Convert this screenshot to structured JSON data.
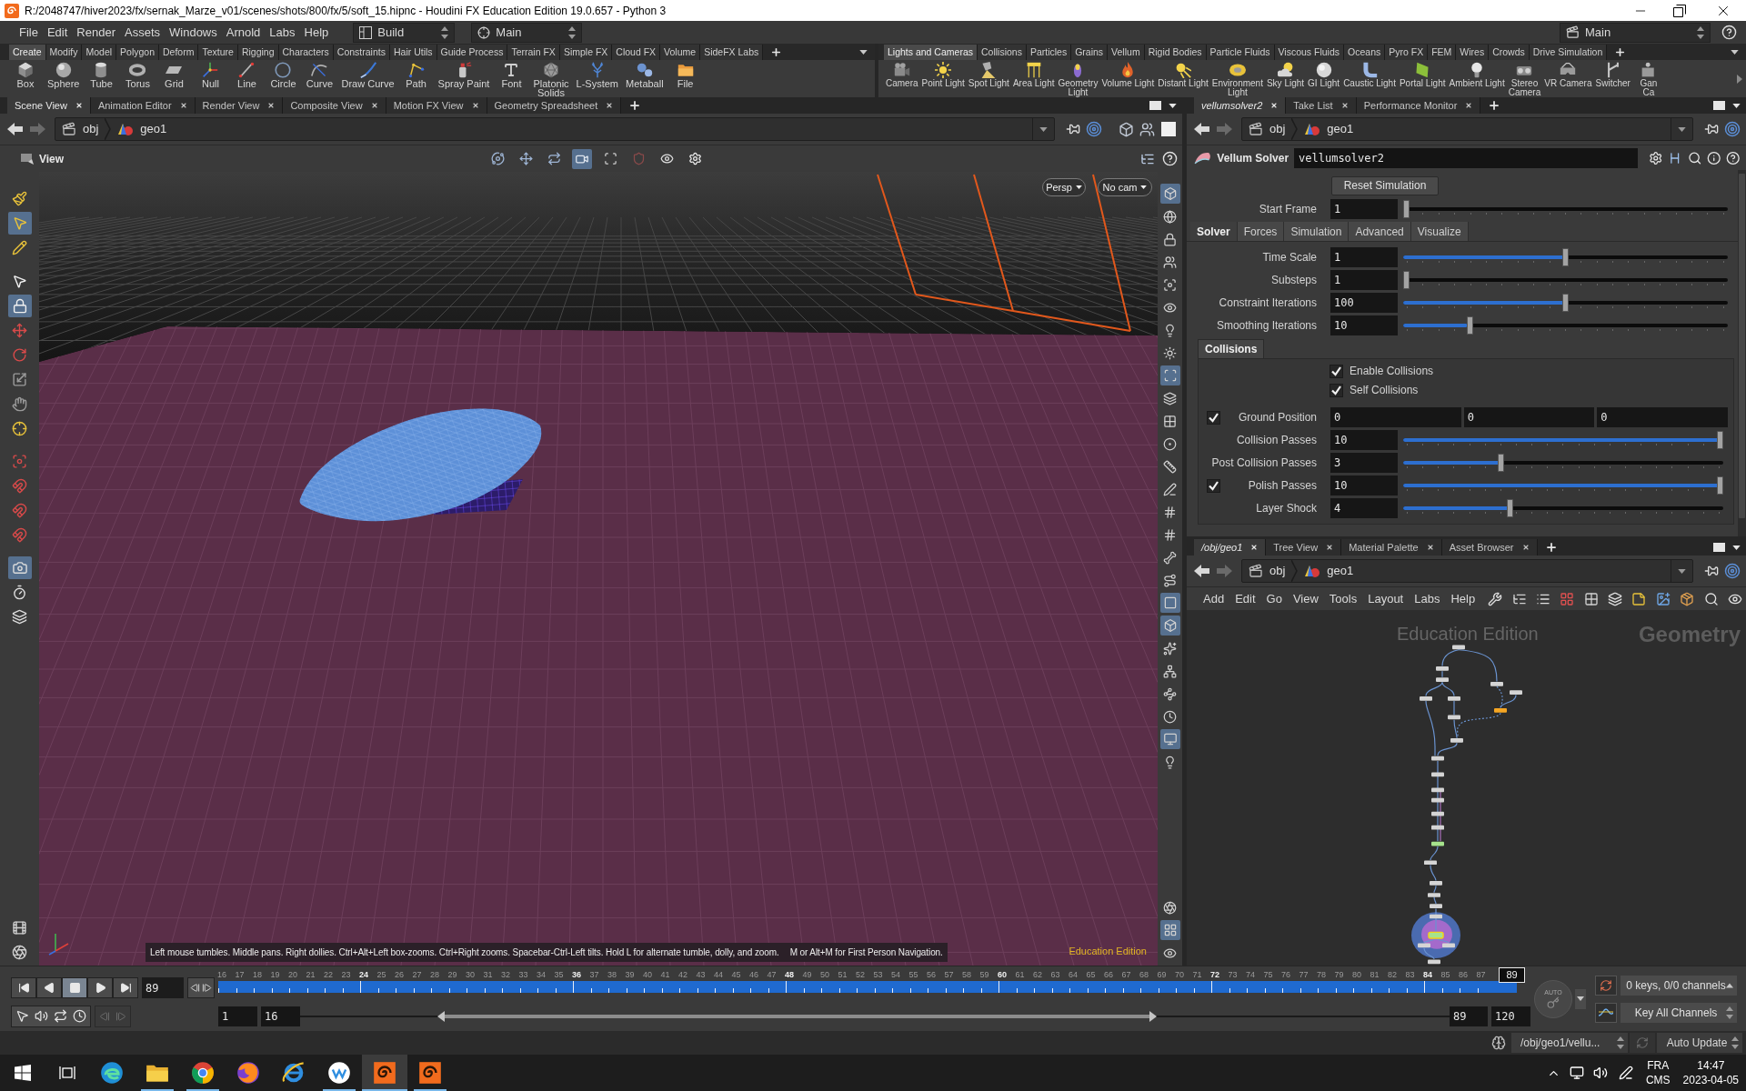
{
  "window": {
    "title": "R:/2048747/hiver2023/fx/sernak_Marze_v01/scenes/shots/800/fx/5/soft_15.hipnc - Houdini FX Education Edition 19.0.657 - Python 3"
  },
  "menu_bar": {
    "items": [
      "File",
      "Edit",
      "Render",
      "Assets",
      "Windows",
      "Arnold",
      "Labs",
      "Help"
    ],
    "desktop": "Build",
    "context": "Main",
    "desk": "Main"
  },
  "shelves": [
    {
      "tabs": [
        {
          "label": "Create",
          "selected": true
        },
        {
          "label": "Modify",
          "selected": false
        },
        {
          "label": "Model",
          "selected": false
        },
        {
          "label": "Polygon",
          "selected": false
        },
        {
          "label": "Deform",
          "selected": false
        },
        {
          "label": "Texture",
          "selected": false
        },
        {
          "label": "Rigging",
          "selected": false
        },
        {
          "label": "Characters",
          "selected": false
        },
        {
          "label": "Constraints",
          "selected": false
        },
        {
          "label": "Hair Utils",
          "selected": false
        },
        {
          "label": "Guide Process",
          "selected": false
        },
        {
          "label": "Terrain FX",
          "selected": false
        },
        {
          "label": "Simple FX",
          "selected": false
        },
        {
          "label": "Cloud FX",
          "selected": false
        },
        {
          "label": "Volume",
          "selected": false
        },
        {
          "label": "SideFX Labs",
          "selected": false
        }
      ],
      "tools": [
        "Box",
        "Sphere",
        "Tube",
        "Torus",
        "Grid",
        "Null",
        "Line",
        "Circle",
        "Curve",
        "Draw Curve",
        "Path",
        "Spray Paint",
        "Font",
        "Platonic\nSolids",
        "L-System",
        "Metaball",
        "File"
      ]
    },
    {
      "tabs": [
        {
          "label": "Lights and Cameras",
          "selected": true
        },
        {
          "label": "Collisions",
          "selected": false
        },
        {
          "label": "Particles",
          "selected": false
        },
        {
          "label": "Grains",
          "selected": false
        },
        {
          "label": "Vellum",
          "selected": false
        },
        {
          "label": "Rigid Bodies",
          "selected": false
        },
        {
          "label": "Particle Fluids",
          "selected": false
        },
        {
          "label": "Viscous Fluids",
          "selected": false
        },
        {
          "label": "Oceans",
          "selected": false
        },
        {
          "label": "Pyro FX",
          "selected": false
        },
        {
          "label": "FEM",
          "selected": false
        },
        {
          "label": "Wires",
          "selected": false
        },
        {
          "label": "Crowds",
          "selected": false
        },
        {
          "label": "Drive Simulation",
          "selected": false
        }
      ],
      "tools": [
        "Camera",
        "Point Light",
        "Spot Light",
        "Area Light",
        "Geometry\nLight",
        "Volume Light",
        "Distant Light",
        "Environment\nLight",
        "Sky Light",
        "GI Light",
        "Caustic Light",
        "Portal Light",
        "Ambient Light",
        "Stereo\nCamera",
        "VR Camera",
        "Switcher",
        "Gan\nCa"
      ]
    }
  ],
  "scene_pane": {
    "tabs": [
      {
        "label": "Scene View",
        "selected": true
      },
      {
        "label": "Animation Editor",
        "selected": false
      },
      {
        "label": "Render View",
        "selected": false
      },
      {
        "label": "Composite View",
        "selected": false
      },
      {
        "label": "Motion FX View",
        "selected": false
      },
      {
        "label": "Geometry Spreadsheet",
        "selected": false
      }
    ],
    "path": [
      "obj",
      "geo1"
    ],
    "viewer_label": "View",
    "view_tools": [
      {
        "selected": false
      },
      {
        "selected": false
      },
      {
        "selected": false
      },
      {
        "selected": true
      },
      {
        "selected": false
      },
      {
        "selected": false
      },
      {
        "selected": false
      },
      {
        "selected": false
      }
    ],
    "left_tools": [
      {
        "selected": false
      },
      {
        "selected": true
      },
      {
        "selected": false
      },
      {
        "selected": false
      },
      {
        "selected": true
      },
      {
        "selected": false
      },
      {
        "selected": false
      },
      {
        "selected": false
      },
      {
        "selected": false
      },
      {
        "selected": false
      },
      {
        "selected": false
      },
      {
        "selected": false
      },
      {
        "selected": false
      },
      {
        "selected": false
      },
      {
        "selected": true
      },
      {
        "selected": false
      },
      {
        "selected": false
      },
      {
        "selected": false
      },
      {
        "selected": false
      }
    ],
    "right_tools": [
      {
        "selected": true
      },
      {
        "selected": false
      },
      {
        "selected": false
      },
      {
        "selected": false
      },
      {
        "selected": false
      },
      {
        "selected": false
      },
      {
        "selected": false
      },
      {
        "selected": false
      },
      {
        "selected": true
      },
      {
        "selected": false
      },
      {
        "selected": false
      },
      {
        "selected": false
      },
      {
        "selected": false
      },
      {
        "selected": false
      },
      {
        "selected": false
      },
      {
        "selected": false
      },
      {
        "selected": false
      },
      {
        "selected": false
      },
      {
        "selected": true
      },
      {
        "selected": true
      },
      {
        "selected": false
      },
      {
        "selected": false
      },
      {
        "selected": false
      },
      {
        "selected": false
      },
      {
        "selected": true
      },
      {
        "selected": false
      },
      {
        "selected": false
      },
      {
        "selected": true
      },
      {
        "selected": false
      }
    ],
    "view_menus": [
      "Persp",
      "No cam"
    ],
    "hints": [
      "Left mouse tumbles. Middle pans. Right dollies. Ctrl+Alt+Left box-zooms. Ctrl+Right zooms. Spacebar-Ctrl-Left tilts. Hold L for alternate tumble, dolly, and zoom.",
      "M or Alt+M for First Person Navigation."
    ],
    "edition": "Education Edition"
  },
  "parameter_pane": {
    "tabs": [
      {
        "label": "vellumsolver2",
        "selected": true
      },
      {
        "label": "Take List",
        "selected": false
      },
      {
        "label": "Performance Monitor",
        "selected": false
      }
    ],
    "path": [
      "obj",
      "geo1"
    ],
    "node_type": "Vellum Solver",
    "node_name": "vellumsolver2",
    "reset_button": "Reset Simulation",
    "start_frame": {
      "label": "Start Frame",
      "value": "1",
      "level": 0
    },
    "folders": [
      {
        "label": "Solver",
        "selected": true
      },
      {
        "label": "Forces",
        "selected": false
      },
      {
        "label": "Simulation",
        "selected": false
      },
      {
        "label": "Advanced",
        "selected": false
      },
      {
        "label": "Visualize",
        "selected": false
      }
    ],
    "solver_params": [
      {
        "label": "Time Scale",
        "value": "1",
        "level": 0.5
      },
      {
        "label": "Substeps",
        "value": "1",
        "level": 0
      },
      {
        "label": "Constraint Iterations",
        "value": "100",
        "level": 0.5
      },
      {
        "label": "Smoothing Iterations",
        "value": "10",
        "level": 0.2
      }
    ],
    "collisions": {
      "folder": {
        "label": "Collisions",
        "selected": true
      },
      "toggles": [
        {
          "label": "Enable Collisions",
          "checked": true
        },
        {
          "label": "Self Collisions",
          "checked": true
        }
      ],
      "params": [
        {
          "kind": "vector",
          "label": "Ground Position",
          "toggle": {
            "checked": true
          },
          "values": [
            "0",
            "0",
            "0"
          ]
        },
        {
          "kind": "slider",
          "label": "Collision Passes",
          "value": "10",
          "level": 1
        },
        {
          "kind": "slider",
          "label": "Post Collision Passes",
          "value": "3",
          "level": 0.3
        },
        {
          "kind": "slider",
          "label": "Polish Passes",
          "toggle": {
            "checked": true
          },
          "value": "10",
          "level": 1
        },
        {
          "kind": "slider",
          "label": "Layer Shock",
          "value": "4",
          "level": 0.33
        }
      ]
    }
  },
  "network_pane": {
    "tabs": [
      {
        "label": "/obj/geo1",
        "selected": true
      },
      {
        "label": "Tree View",
        "selected": false
      },
      {
        "label": "Material Palette",
        "selected": false
      },
      {
        "label": "Asset Browser",
        "selected": false
      }
    ],
    "path": [
      "obj",
      "geo1"
    ],
    "menu": [
      "Add",
      "Edit",
      "Go",
      "View",
      "Tools",
      "Layout",
      "Labs",
      "Help"
    ],
    "watermark": "Education Edition",
    "context": "Geometry"
  },
  "timeline": {
    "playback": [
      {
        "selected": false
      },
      {
        "selected": false
      },
      {
        "selected": true
      },
      {
        "selected": false
      },
      {
        "selected": false
      }
    ],
    "frame": "89",
    "ticks": [
      {
        "label": "16",
        "major": false
      },
      {
        "label": "17",
        "major": false
      },
      {
        "label": "18",
        "major": false
      },
      {
        "label": "19",
        "major": false
      },
      {
        "label": "20",
        "major": false
      },
      {
        "label": "21",
        "major": false
      },
      {
        "label": "22",
        "major": false
      },
      {
        "label": "23",
        "major": false
      },
      {
        "label": "24",
        "major": true
      },
      {
        "label": "25",
        "major": false
      },
      {
        "label": "26",
        "major": false
      },
      {
        "label": "27",
        "major": false
      },
      {
        "label": "28",
        "major": false
      },
      {
        "label": "29",
        "major": false
      },
      {
        "label": "30",
        "major": false
      },
      {
        "label": "31",
        "major": false
      },
      {
        "label": "32",
        "major": false
      },
      {
        "label": "33",
        "major": false
      },
      {
        "label": "34",
        "major": false
      },
      {
        "label": "35",
        "major": false
      },
      {
        "label": "36",
        "major": true
      },
      {
        "label": "37",
        "major": false
      },
      {
        "label": "38",
        "major": false
      },
      {
        "label": "39",
        "major": false
      },
      {
        "label": "40",
        "major": false
      },
      {
        "label": "41",
        "major": false
      },
      {
        "label": "42",
        "major": false
      },
      {
        "label": "43",
        "major": false
      },
      {
        "label": "44",
        "major": false
      },
      {
        "label": "45",
        "major": false
      },
      {
        "label": "46",
        "major": false
      },
      {
        "label": "47",
        "major": false
      },
      {
        "label": "48",
        "major": true
      },
      {
        "label": "49",
        "major": false
      },
      {
        "label": "50",
        "major": false
      },
      {
        "label": "51",
        "major": false
      },
      {
        "label": "52",
        "major": false
      },
      {
        "label": "53",
        "major": false
      },
      {
        "label": "54",
        "major": false
      },
      {
        "label": "55",
        "major": false
      },
      {
        "label": "56",
        "major": false
      },
      {
        "label": "57",
        "major": false
      },
      {
        "label": "58",
        "major": false
      },
      {
        "label": "59",
        "major": false
      },
      {
        "label": "60",
        "major": true
      },
      {
        "label": "61",
        "major": false
      },
      {
        "label": "62",
        "major": false
      },
      {
        "label": "63",
        "major": false
      },
      {
        "label": "64",
        "major": false
      },
      {
        "label": "65",
        "major": false
      },
      {
        "label": "66",
        "major": false
      },
      {
        "label": "67",
        "major": false
      },
      {
        "label": "68",
        "major": false
      },
      {
        "label": "69",
        "major": false
      },
      {
        "label": "70",
        "major": false
      },
      {
        "label": "71",
        "major": false
      },
      {
        "label": "72",
        "major": true
      },
      {
        "label": "73",
        "major": false
      },
      {
        "label": "74",
        "major": false
      },
      {
        "label": "75",
        "major": false
      },
      {
        "label": "76",
        "major": false
      },
      {
        "label": "77",
        "major": false
      },
      {
        "label": "78",
        "major": false
      },
      {
        "label": "79",
        "major": false
      },
      {
        "label": "80",
        "major": false
      },
      {
        "label": "81",
        "major": false
      },
      {
        "label": "82",
        "major": false
      },
      {
        "label": "83",
        "major": false
      },
      {
        "label": "84",
        "major": true
      },
      {
        "label": "85",
        "major": false
      },
      {
        "label": "86",
        "major": false
      },
      {
        "label": "87",
        "major": false
      }
    ],
    "marker": "89",
    "range": [
      "1",
      "16",
      "89",
      "120"
    ],
    "range_slider": {
      "handles": [
        {
          "level": 0.126
        },
        {
          "level": 0.739
        }
      ]
    },
    "auto_key": "AUTO",
    "keys_info": "0 keys, 0/0 channels",
    "key_mode": "Key All Channels"
  },
  "status_bar": {
    "path": "/obj/geo1/vellu...",
    "update_mode": "Auto Update"
  },
  "taskbar": {
    "apps": [
      {
        "running": false,
        "active": false
      },
      {
        "running": true,
        "active": false
      },
      {
        "running": true,
        "active": false
      },
      {
        "running": false,
        "active": false
      },
      {
        "running": false,
        "active": false
      },
      {
        "running": true,
        "active": false
      },
      {
        "running": true,
        "active": true
      },
      {
        "running": true,
        "active": false
      }
    ],
    "language": "FRA",
    "layout": "CMS",
    "time": "14:47",
    "date": "2023-04-05"
  }
}
